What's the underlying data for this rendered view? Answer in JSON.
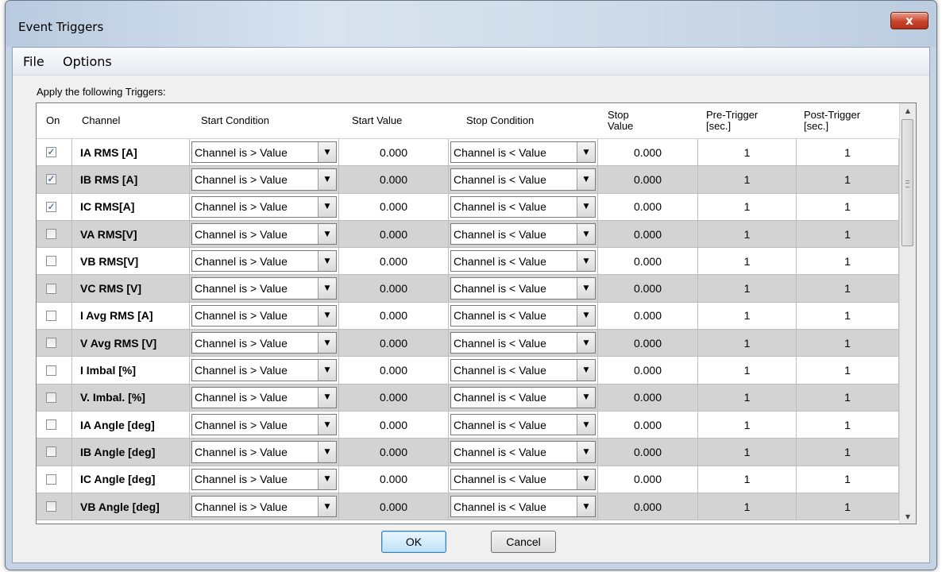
{
  "window": {
    "title": "Event Triggers",
    "close_glyph": "x"
  },
  "menu": {
    "file": "File",
    "options": "Options"
  },
  "apply_label": "Apply the following Triggers:",
  "columns": {
    "on": "On",
    "channel": "Channel",
    "start_condition": "Start Condition",
    "start_value": "Start Value",
    "stop_condition": "Stop Condition",
    "stop_value_1": "Stop",
    "stop_value_2": "Value",
    "pre_trigger_1": "Pre-Trigger",
    "pre_trigger_2": "[sec.]",
    "post_trigger_1": "Post-Trigger",
    "post_trigger_2": "[sec.]"
  },
  "rows": [
    {
      "on": true,
      "channel": "IA RMS [A]",
      "start_condition": "Channel is > Value",
      "start_value": "0.000",
      "stop_condition": "Channel is < Value",
      "stop_value": "0.000",
      "pre": "1",
      "post": "1"
    },
    {
      "on": true,
      "channel": "IB RMS [A]",
      "start_condition": "Channel is > Value",
      "start_value": "0.000",
      "stop_condition": "Channel is < Value",
      "stop_value": "0.000",
      "pre": "1",
      "post": "1"
    },
    {
      "on": true,
      "channel": "IC RMS[A]",
      "start_condition": "Channel is > Value",
      "start_value": "0.000",
      "stop_condition": "Channel is < Value",
      "stop_value": "0.000",
      "pre": "1",
      "post": "1"
    },
    {
      "on": false,
      "channel": "VA RMS[V]",
      "start_condition": "Channel is > Value",
      "start_value": "0.000",
      "stop_condition": "Channel is < Value",
      "stop_value": "0.000",
      "pre": "1",
      "post": "1"
    },
    {
      "on": false,
      "channel": "VB RMS[V]",
      "start_condition": "Channel is > Value",
      "start_value": "0.000",
      "stop_condition": "Channel is < Value",
      "stop_value": "0.000",
      "pre": "1",
      "post": "1"
    },
    {
      "on": false,
      "channel": "VC RMS [V]",
      "start_condition": "Channel is > Value",
      "start_value": "0.000",
      "stop_condition": "Channel is < Value",
      "stop_value": "0.000",
      "pre": "1",
      "post": "1"
    },
    {
      "on": false,
      "channel": "I Avg RMS [A]",
      "start_condition": "Channel is > Value",
      "start_value": "0.000",
      "stop_condition": "Channel is < Value",
      "stop_value": "0.000",
      "pre": "1",
      "post": "1"
    },
    {
      "on": false,
      "channel": "V Avg RMS [V]",
      "start_condition": "Channel is > Value",
      "start_value": "0.000",
      "stop_condition": "Channel is < Value",
      "stop_value": "0.000",
      "pre": "1",
      "post": "1"
    },
    {
      "on": false,
      "channel": "I Imbal [%]",
      "start_condition": "Channel is > Value",
      "start_value": "0.000",
      "stop_condition": "Channel is < Value",
      "stop_value": "0.000",
      "pre": "1",
      "post": "1"
    },
    {
      "on": false,
      "channel": "V. Imbal. [%]",
      "start_condition": "Channel is > Value",
      "start_value": "0.000",
      "stop_condition": "Channel is < Value",
      "stop_value": "0.000",
      "pre": "1",
      "post": "1"
    },
    {
      "on": false,
      "channel": "IA Angle [deg]",
      "start_condition": "Channel is > Value",
      "start_value": "0.000",
      "stop_condition": "Channel is < Value",
      "stop_value": "0.000",
      "pre": "1",
      "post": "1"
    },
    {
      "on": false,
      "channel": "IB Angle [deg]",
      "start_condition": "Channel is > Value",
      "start_value": "0.000",
      "stop_condition": "Channel is < Value",
      "stop_value": "0.000",
      "pre": "1",
      "post": "1"
    },
    {
      "on": false,
      "channel": "IC Angle [deg]",
      "start_condition": "Channel is > Value",
      "start_value": "0.000",
      "stop_condition": "Channel is < Value",
      "stop_value": "0.000",
      "pre": "1",
      "post": "1"
    },
    {
      "on": false,
      "channel": "VB Angle [deg]",
      "start_condition": "Channel is > Value",
      "start_value": "0.000",
      "stop_condition": "Channel is < Value",
      "stop_value": "0.000",
      "pre": "1",
      "post": "1"
    }
  ],
  "buttons": {
    "ok": "OK",
    "cancel": "Cancel"
  },
  "icons": {
    "checkbox_checked": "✓",
    "combo_arrow": "▼",
    "scroll_up": "▲",
    "scroll_down": "▼"
  },
  "colors": {
    "alt_row": "#d3d3d3",
    "check": "#2d4f86"
  }
}
